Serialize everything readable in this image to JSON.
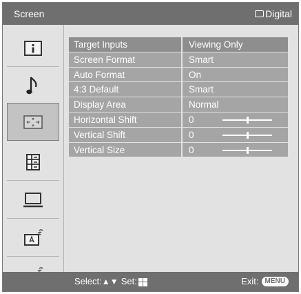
{
  "header": {
    "title": "Screen",
    "source_label": "Digital",
    "source_icon": "screen-outline-icon"
  },
  "sidebar": {
    "items": [
      {
        "name": "picture-icon"
      },
      {
        "name": "sound-icon"
      },
      {
        "name": "screen-icon",
        "selected": true
      },
      {
        "name": "features-icon"
      },
      {
        "name": "pc-settings-icon"
      },
      {
        "name": "analog-setup-icon"
      },
      {
        "name": "digital-setup-icon"
      }
    ]
  },
  "menu": {
    "rows": [
      {
        "label": "Target Inputs",
        "value": "Viewing Only"
      },
      {
        "label": "Screen Format",
        "value": "Smart"
      },
      {
        "label": "Auto Format",
        "value": "On"
      },
      {
        "label": "4:3 Default",
        "value": "Smart"
      },
      {
        "label": "Display Area",
        "value": "Normal"
      },
      {
        "label": "Horizontal Shift",
        "value": "0",
        "slider_level": 0.5
      },
      {
        "label": "Vertical Shift",
        "value": "0",
        "slider_level": 0.5
      },
      {
        "label": "Vertical Size",
        "value": "0",
        "slider_level": 0.5
      }
    ]
  },
  "footer": {
    "select_label": "Select:",
    "set_label": "Set:",
    "exit_label": "Exit:",
    "menu_button": "MENU"
  },
  "colors": {
    "bar": "#6f6f6f",
    "panel": "#e2e2e2",
    "row": "#a5a5a5",
    "row_highlight": "#8e8e8e"
  }
}
